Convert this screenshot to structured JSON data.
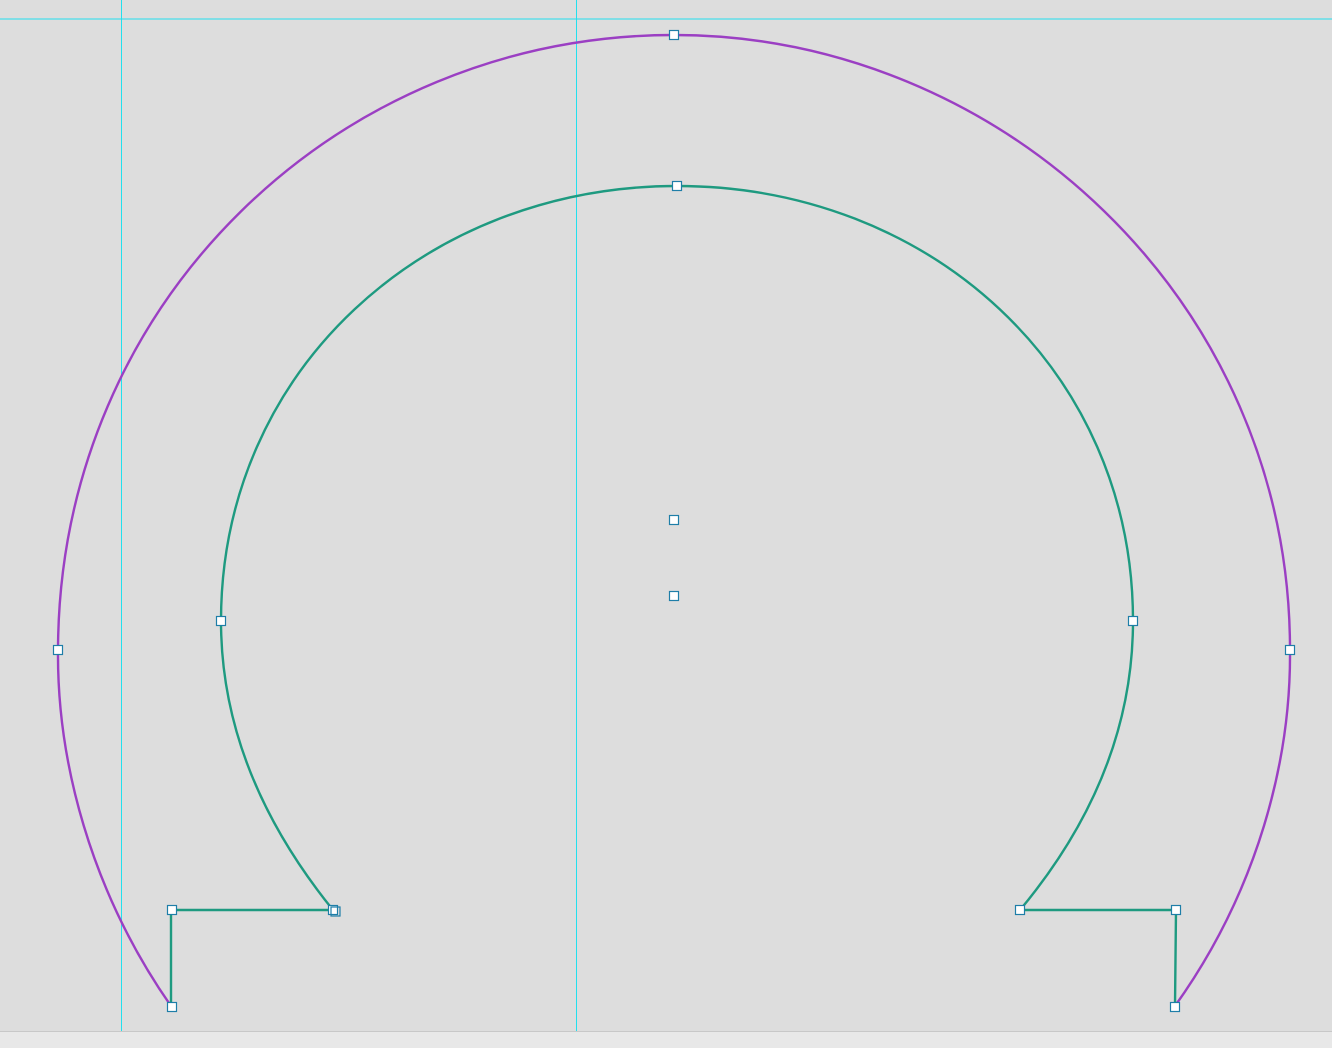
{
  "canvas": {
    "background": "#dddddd",
    "guide_color": "#22e0ee",
    "outer_path_color": "#9b3fc3",
    "inner_path_color": "#1e9a80",
    "anchor_fill": "#ffffff",
    "anchor_stroke": "#1e7ea8"
  },
  "status_bar": {
    "text": ""
  }
}
